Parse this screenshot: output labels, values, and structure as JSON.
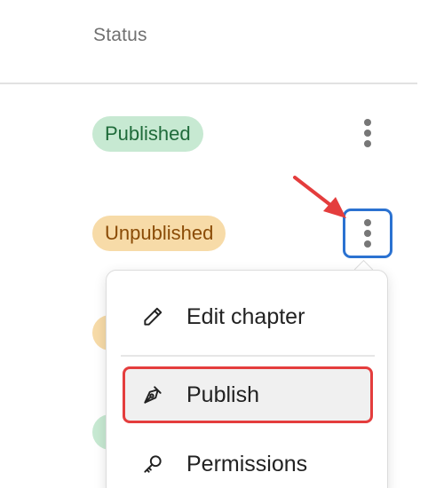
{
  "table": {
    "status_header": "Status",
    "rows": [
      {
        "status": "Published",
        "status_color": "#c7e9d2"
      },
      {
        "status": "Unpublished",
        "status_color": "#f7dba8"
      }
    ],
    "row_action_icon": "kebab-menu-icon"
  },
  "context_menu": {
    "items": [
      {
        "label": "Edit chapter",
        "icon": "pencil-icon"
      },
      {
        "label": "Publish",
        "icon": "pen-nib-icon",
        "highlighted": true
      },
      {
        "label": "Permissions",
        "icon": "key-icon"
      }
    ]
  },
  "annotation": {
    "arrow_color": "#e43d3d",
    "highlight_color": "#e43d3d",
    "focus_color": "#2b72d1"
  }
}
